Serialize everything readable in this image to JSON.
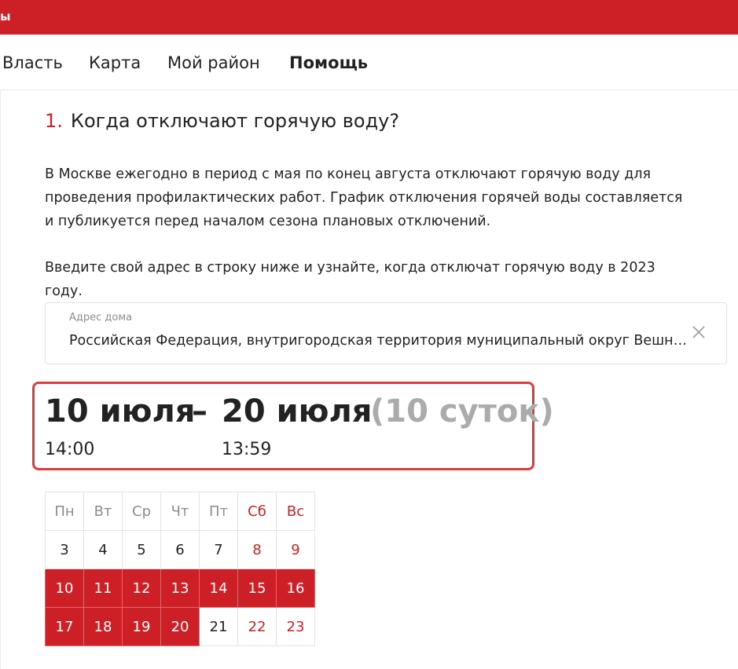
{
  "topbar": {
    "text": "ы"
  },
  "nav": {
    "items": [
      "Власть",
      "Карта",
      "Мой район",
      "Помощь"
    ],
    "active": "Помощь"
  },
  "question": {
    "number": "1.",
    "title": "Когда отключают горячую воду?"
  },
  "intro_text": "В Москве ежегодно в период с мая по конец августа отключают горячую воду для проведения профилактических работ. График отключения горячей воды составляется и публикуется перед началом сезона плановых отключений.",
  "prompt_text": "Введите свой адрес в строку ниже и узнайте, когда отключат горячую воду в 2023 году.",
  "address": {
    "label": "Адрес дома",
    "value": "Российская Федерация,  внутригородская территория муниципальный округ Вешн…",
    "clear_icon": "close-icon"
  },
  "period": {
    "start_date": "10 июля",
    "dash": "–",
    "end_date": "20 июля",
    "duration": "(10 суток)",
    "start_time": "14:00",
    "end_time": "13:59",
    "border_color": "#e0393e"
  },
  "calendar": {
    "weekdays": [
      "Пн",
      "Вт",
      "Ср",
      "Чт",
      "Пт",
      "Сб",
      "Вс"
    ],
    "rows": [
      [
        "3",
        "4",
        "5",
        "6",
        "7",
        "8",
        "9"
      ],
      [
        "10",
        "11",
        "12",
        "13",
        "14",
        "15",
        "16"
      ],
      [
        "17",
        "18",
        "19",
        "20",
        "21",
        "22",
        "23"
      ]
    ],
    "highlighted": [
      "10",
      "11",
      "12",
      "13",
      "14",
      "15",
      "16",
      "17",
      "18",
      "19",
      "20"
    ],
    "accent_color": "#cd2026"
  }
}
